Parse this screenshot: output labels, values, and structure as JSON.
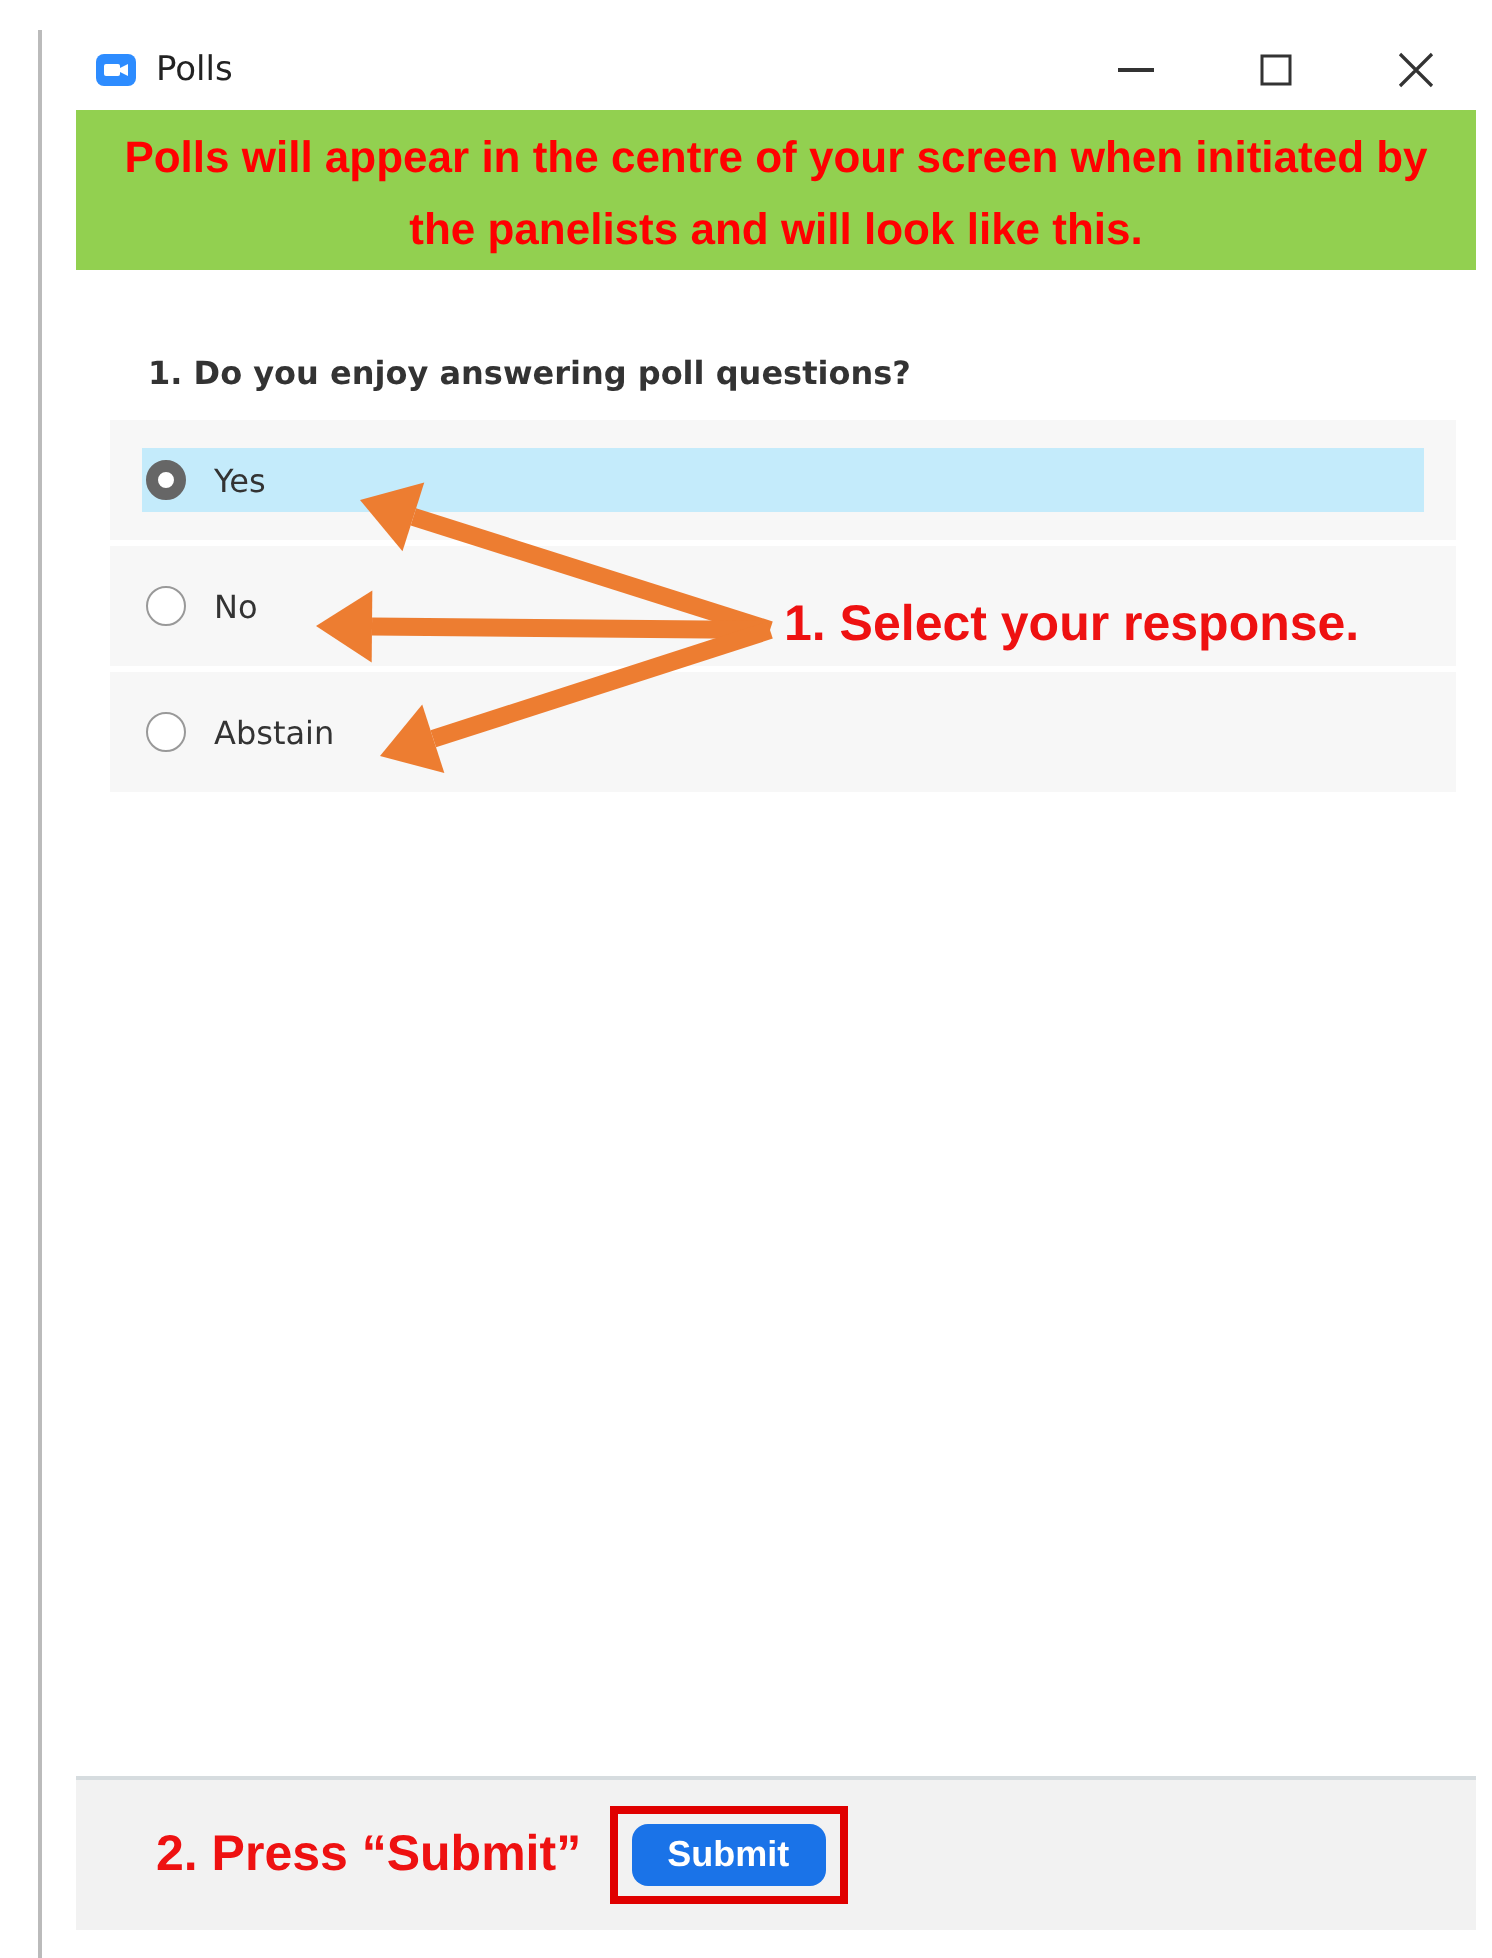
{
  "window": {
    "title": "Polls"
  },
  "banner": "Polls will appear in the centre of your screen when initiated by the panelists and will look like this.",
  "question": "1. Do you enjoy answering poll questions?",
  "options": [
    {
      "label": "Yes",
      "selected": true
    },
    {
      "label": "No",
      "selected": false
    },
    {
      "label": "Abstain",
      "selected": false
    }
  ],
  "step_1": "1.  Select your response.",
  "step_2": "2.  Press “Submit”",
  "submit_button": "Submit"
}
